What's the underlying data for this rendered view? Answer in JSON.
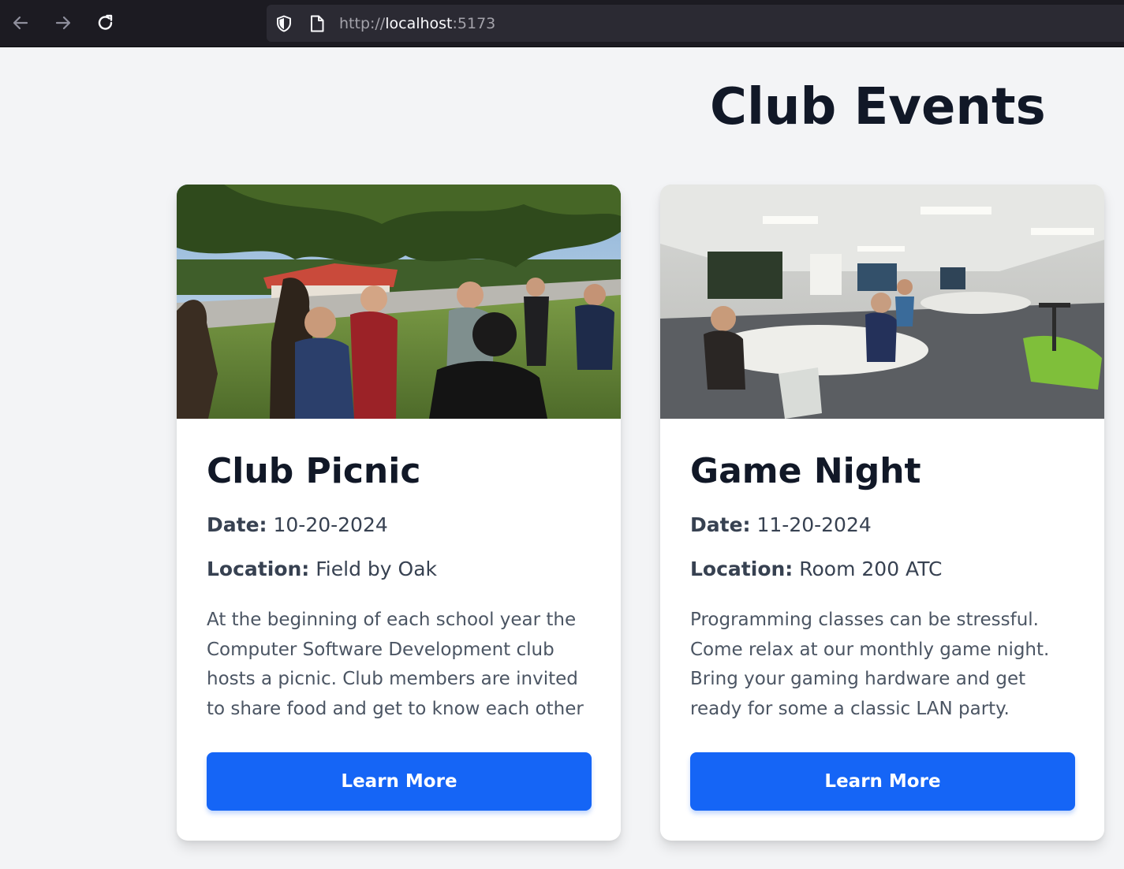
{
  "browser": {
    "url_scheme": "http://",
    "url_host": "localhost",
    "url_port": ":5173"
  },
  "page": {
    "title": "Club Events"
  },
  "events": [
    {
      "title": "Club Picnic",
      "date_label": "Date:",
      "date": "10-20-2024",
      "location_label": "Location:",
      "location": "Field by Oak",
      "description": "At the beginning of each school year the Computer Software Development club hosts a picnic. Club members are invited to share food and get to know each other",
      "button_label": "Learn More",
      "image": "outdoor-picnic-photo"
    },
    {
      "title": "Game Night",
      "date_label": "Date:",
      "date": "11-20-2024",
      "location_label": "Location:",
      "location": "Room 200 ATC",
      "description": "Programming classes can be stressful. Come relax at our monthly game night. Bring your gaming hardware and get ready for some a classic LAN party.",
      "button_label": "Learn More",
      "image": "indoor-gaming-room-photo"
    }
  ],
  "colors": {
    "button": "#1565f6",
    "title": "#111827",
    "background": "#f3f4f6"
  }
}
